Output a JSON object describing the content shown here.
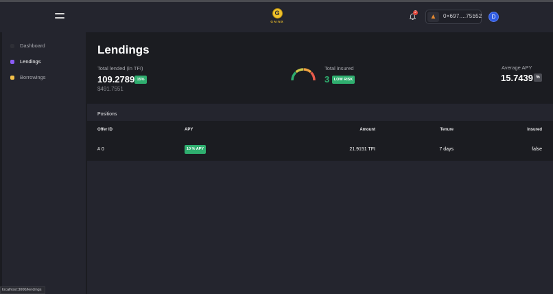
{
  "header": {
    "logo_text": "GAINX",
    "logo_glyph": "G",
    "notification_count": "2",
    "wallet_address": "0×697....75b52",
    "profile_glyph": "D"
  },
  "sidebar": {
    "items": [
      {
        "label": "Dashboard",
        "color": "#2e2f36",
        "active": false
      },
      {
        "label": "Lendings",
        "color": "#8b5cf6",
        "active": true
      },
      {
        "label": "Borrowings",
        "color": "#f5c24a",
        "active": false
      }
    ]
  },
  "main": {
    "title": "Lendings",
    "total_lended": {
      "label": "Total lended (in TFI)",
      "value": "109.2789",
      "badge": "15%",
      "usd_value": "$491.7551"
    },
    "total_insured": {
      "label": "Total insured",
      "value": "3",
      "badge": "LOW RISK"
    },
    "average_apy": {
      "label": "Average APY",
      "value": "15.7439",
      "badge": "%"
    }
  },
  "positions": {
    "title": "Positions",
    "columns": [
      "Offer ID",
      "APY",
      "Amount",
      "Tenure",
      "Insured"
    ],
    "rows": [
      {
        "offer_id": "# 0",
        "apy": "10 % APY",
        "amount": "21.9151 TFI",
        "tenure": "7 days",
        "insured": "false"
      }
    ]
  },
  "statusbar": {
    "url": "localhost:3000/lendings"
  },
  "colors": {
    "accent_green": "#2fae6f",
    "background": "#1b1c21",
    "panel": "#24252e",
    "gold": "#f0c22b"
  }
}
